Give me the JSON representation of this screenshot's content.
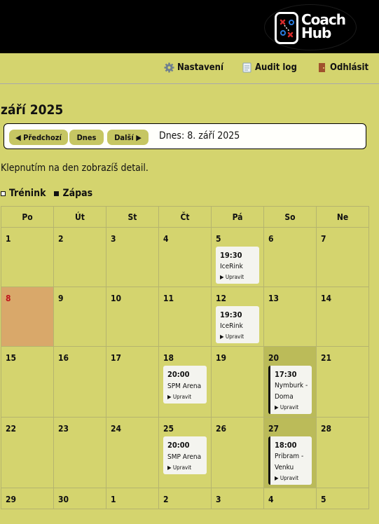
{
  "app": {
    "logo_text_1": "Coach",
    "logo_text_2": "Hub"
  },
  "nav": {
    "items": [
      {
        "label": "Nastavení",
        "icon": "gear-icon"
      },
      {
        "label": "Audit log",
        "icon": "document-icon"
      },
      {
        "label": "Odhlásit",
        "icon": "door-icon"
      }
    ]
  },
  "calendar": {
    "month_title": "září 2025",
    "prev_label": "◀ Předchozí",
    "today_button": "Dnes",
    "next_label": "Další ▶",
    "today_text": "Dnes: 8. září 2025",
    "hint": "Klepnutím na den zobrazíš detail.",
    "legend": {
      "training": "Trénink",
      "match": "Zápas"
    },
    "weekdays": [
      "Po",
      "Út",
      "St",
      "Čt",
      "Pá",
      "So",
      "Ne"
    ],
    "weeks": [
      [
        "1",
        "2",
        "3",
        "4",
        "5",
        "6",
        "7"
      ],
      [
        "8",
        "9",
        "10",
        "11",
        "12",
        "13",
        "14"
      ],
      [
        "15",
        "16",
        "17",
        "18",
        "19",
        "20",
        "21"
      ],
      [
        "22",
        "23",
        "24",
        "25",
        "26",
        "27",
        "28"
      ],
      [
        "29",
        "30",
        "1",
        "2",
        "3",
        "4",
        "5"
      ]
    ],
    "events": [
      {
        "time": "19:30",
        "title": "IceRink",
        "edit": "▶ Upravit"
      },
      {
        "time": "19:30",
        "title": "IceRink",
        "edit": "▶ Upravit"
      },
      {
        "time": "20:00",
        "title": "SPM Arena",
        "edit": "▶ Upravit"
      },
      {
        "time": "17:30",
        "title": "Nymburk - Doma",
        "edit": "▶ Upravit"
      },
      {
        "time": "20:00",
        "title": "SMP Arena",
        "edit": "▶ Upravit"
      },
      {
        "time": "18:00",
        "title": "Pribram - Venku",
        "edit": "▶ Upravit"
      }
    ]
  },
  "colors": {
    "background": "#d4d46e",
    "header": "#000000",
    "today": "#d9a86a",
    "highlight": "#bbbb59",
    "today_number": "#c0141c"
  }
}
